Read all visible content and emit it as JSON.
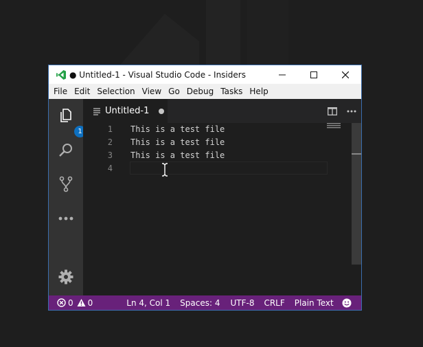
{
  "window": {
    "title": "● Untitled-1 - Visual Studio Code - Insiders"
  },
  "menu": [
    "File",
    "Edit",
    "Selection",
    "View",
    "Go",
    "Debug",
    "Tasks",
    "Help"
  ],
  "activity_bar": {
    "explorer_badge": "1",
    "icons": [
      "explorer-icon",
      "search-icon",
      "source-control-icon",
      "more-icon",
      "gear-icon"
    ]
  },
  "tab": {
    "label": "Untitled-1"
  },
  "editor": {
    "lines": [
      {
        "number": "1",
        "text": "This is a test file"
      },
      {
        "number": "2",
        "text": "This is a test file"
      },
      {
        "number": "3",
        "text": "This is a test file"
      },
      {
        "number": "4",
        "text": ""
      }
    ]
  },
  "status_bar": {
    "errors": "0",
    "warnings": "0",
    "position": "Ln 4, Col 1",
    "spaces": "Spaces: 4",
    "encoding": "UTF-8",
    "eol": "CRLF",
    "language": "Plain Text"
  },
  "colors": {
    "status_bar": "#68217a",
    "activity_bar": "#333333",
    "editor_bg": "#1e1e1e",
    "badge": "#0e70c0",
    "logo": "#24a148"
  }
}
